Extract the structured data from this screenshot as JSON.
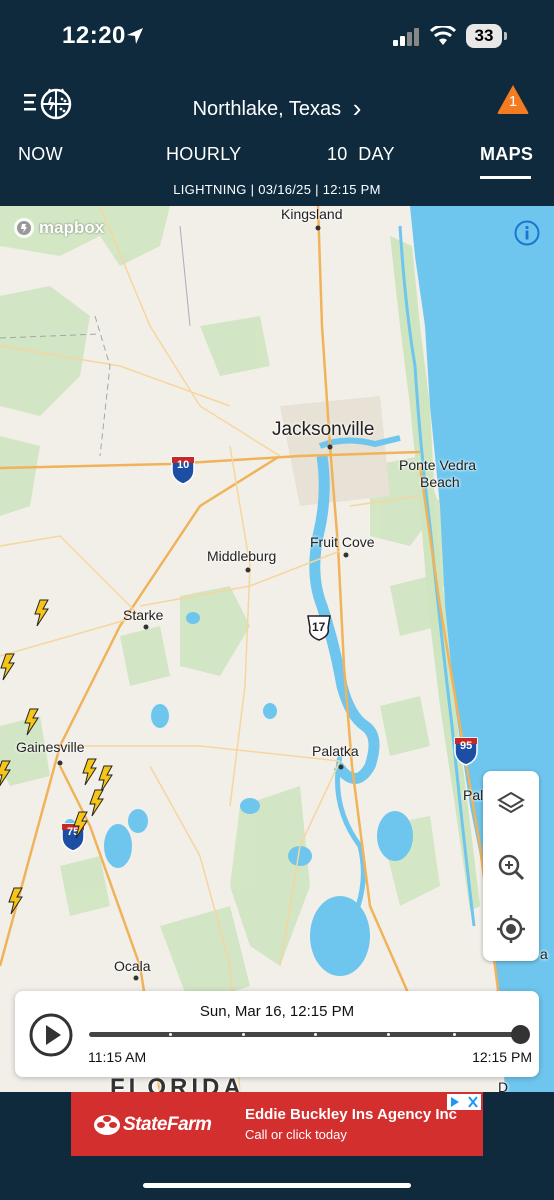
{
  "status_bar": {
    "time": "12:20",
    "battery": "33"
  },
  "header": {
    "location": "Northlake, Texas",
    "location_chevron": "›",
    "alert_count": "1"
  },
  "tabs": [
    {
      "label": "NOW",
      "active": false
    },
    {
      "label": "HOURLY",
      "active": false
    },
    {
      "label": "10  DAY",
      "active": false
    },
    {
      "label": "MAPS",
      "active": true
    }
  ],
  "subtitle": "LIGHTNING | 03/16/25 | 12:15 PM",
  "map": {
    "attribution": "mapbox",
    "labels": {
      "kingsland": "Kingsland",
      "jacksonville": "Jacksonville",
      "ponte_vedra_1": "Ponte Vedra",
      "ponte_vedra_2": "Beach",
      "fruit_cove": "Fruit Cove",
      "middleburg": "Middleburg",
      "starke": "Starke",
      "gainesville": "Gainesville",
      "palatka": "Palatka",
      "palm_coast": "Palm Coast",
      "ocala": "Ocala",
      "florida": "FLORIDA",
      "deltona_partial": "D",
      "edge_partial": "a",
      "i10": "10",
      "i75": "75",
      "i95": "95",
      "us17": "17"
    },
    "icons": [
      "info-icon",
      "layers-icon",
      "zoom-in-icon",
      "locate-icon",
      "lightning-icon"
    ]
  },
  "player": {
    "date": "Sun, Mar 16, 12:15 PM",
    "start_time": "11:15 AM",
    "end_time": "12:15 PM",
    "progress": 1.0
  },
  "ad": {
    "brand": "StateFarm",
    "title": "Eddie Buckley Ins Agency Inc",
    "subtitle": "Call or click today"
  },
  "colors": {
    "header_bg": "#0f2a3d",
    "alert": "#f47b20",
    "ad_bg": "#d32f2f",
    "water": "#6ec6ee",
    "lightning": "#f5c518"
  }
}
